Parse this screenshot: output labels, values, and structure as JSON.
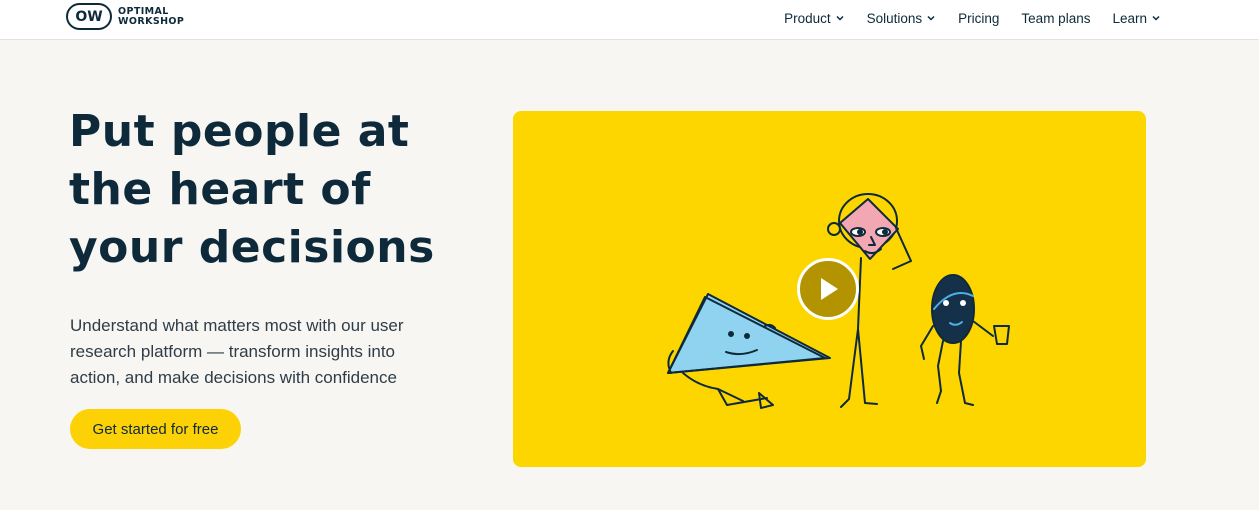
{
  "brand": {
    "mark": "OW",
    "name_line1": "OPTIMAL",
    "name_line2": "WORKSHOP"
  },
  "nav": {
    "items": [
      {
        "label": "Product",
        "has_dropdown": true
      },
      {
        "label": "Solutions",
        "has_dropdown": true
      },
      {
        "label": "Pricing",
        "has_dropdown": false
      },
      {
        "label": "Team plans",
        "has_dropdown": false
      },
      {
        "label": "Learn",
        "has_dropdown": true
      }
    ]
  },
  "hero": {
    "title": "Put people at the heart of your decisions",
    "description": "Understand what matters most with our user research platform — transform insights into action, and make decisions with confidence",
    "cta_label": "Get started for free"
  },
  "video": {
    "play_icon": "play-icon",
    "background_color": "#fdd600"
  },
  "colors": {
    "accent": "#fcd207",
    "text": "#0e2a3a",
    "page_bg": "#f8f6f3"
  }
}
